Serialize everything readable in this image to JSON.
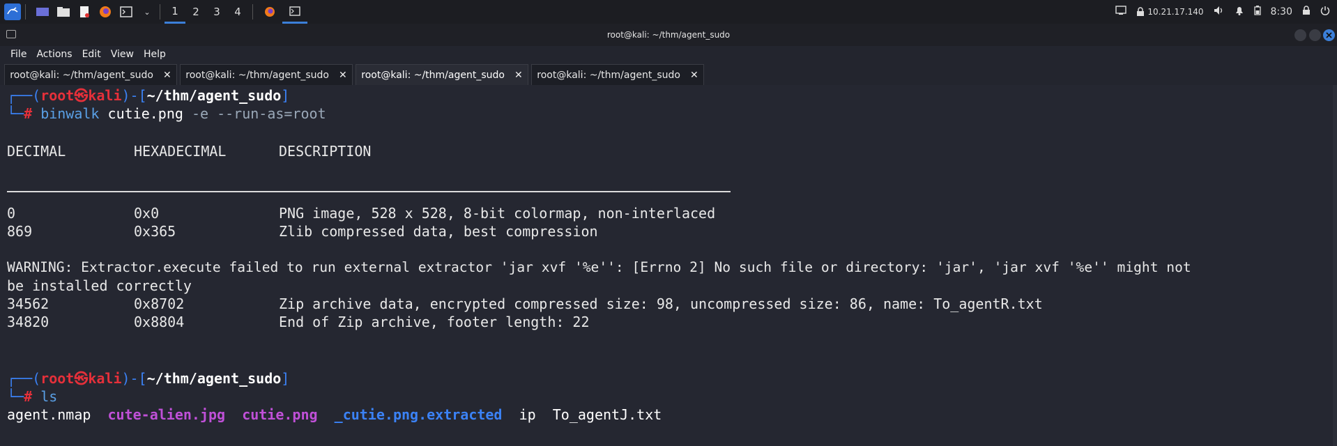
{
  "panel": {
    "workspaces": [
      "1",
      "2",
      "3",
      "4"
    ],
    "tray": {
      "ip": "10.21.17.140",
      "clock": "8:30"
    }
  },
  "window": {
    "title": "root@kali: ~/thm/agent_sudo"
  },
  "menu": [
    "File",
    "Actions",
    "Edit",
    "View",
    "Help"
  ],
  "tabs": [
    {
      "label": "root@kali: ~/thm/agent_sudo",
      "active": false
    },
    {
      "label": "root@kali: ~/thm/agent_sudo",
      "active": false
    },
    {
      "label": "root@kali: ~/thm/agent_sudo",
      "active": true
    },
    {
      "label": "root@kali: ~/thm/agent_sudo",
      "active": false
    }
  ],
  "terminal": {
    "prompt": {
      "user": "root",
      "skull": "㉿",
      "host": "kali",
      "path": "~/thm/agent_sudo"
    },
    "cmd1": {
      "program": "binwalk",
      "file": "cutie.png",
      "args": "-e --run-as=root"
    },
    "headers": [
      "DECIMAL",
      "HEXADECIMAL",
      "DESCRIPTION"
    ],
    "rows": [
      {
        "dec": "0",
        "hex": "0x0",
        "desc": "PNG image, 528 x 528, 8-bit colormap, non-interlaced"
      },
      {
        "dec": "869",
        "hex": "0x365",
        "desc": "Zlib compressed data, best compression"
      }
    ],
    "warning_1": "WARNING: Extractor.execute failed to run external extractor 'jar xvf '%e'': [Errno 2] No such file or directory: 'jar', 'jar xvf '%e'' might not",
    "warning_2": "be installed correctly",
    "rows2": [
      {
        "dec": "34562",
        "hex": "0x8702",
        "desc": "Zip archive data, encrypted compressed size: 98, uncompressed size: 86, name: To_agentR.txt"
      },
      {
        "dec": "34820",
        "hex": "0x8804",
        "desc": "End of Zip archive, footer length: 22"
      }
    ],
    "cmd2": "ls",
    "ls": {
      "f1": "agent.nmap",
      "f2": "cute-alien.jpg",
      "f3": "cutie.png",
      "f4": "_cutie.png.extracted",
      "f5": "ip",
      "f6": "To_agentJ.txt"
    }
  },
  "colors": {
    "accent": "#3b7fd9",
    "prompt_red": "#e5303a",
    "image_magenta": "#c050d8",
    "dir_blue": "#3b82f6"
  }
}
